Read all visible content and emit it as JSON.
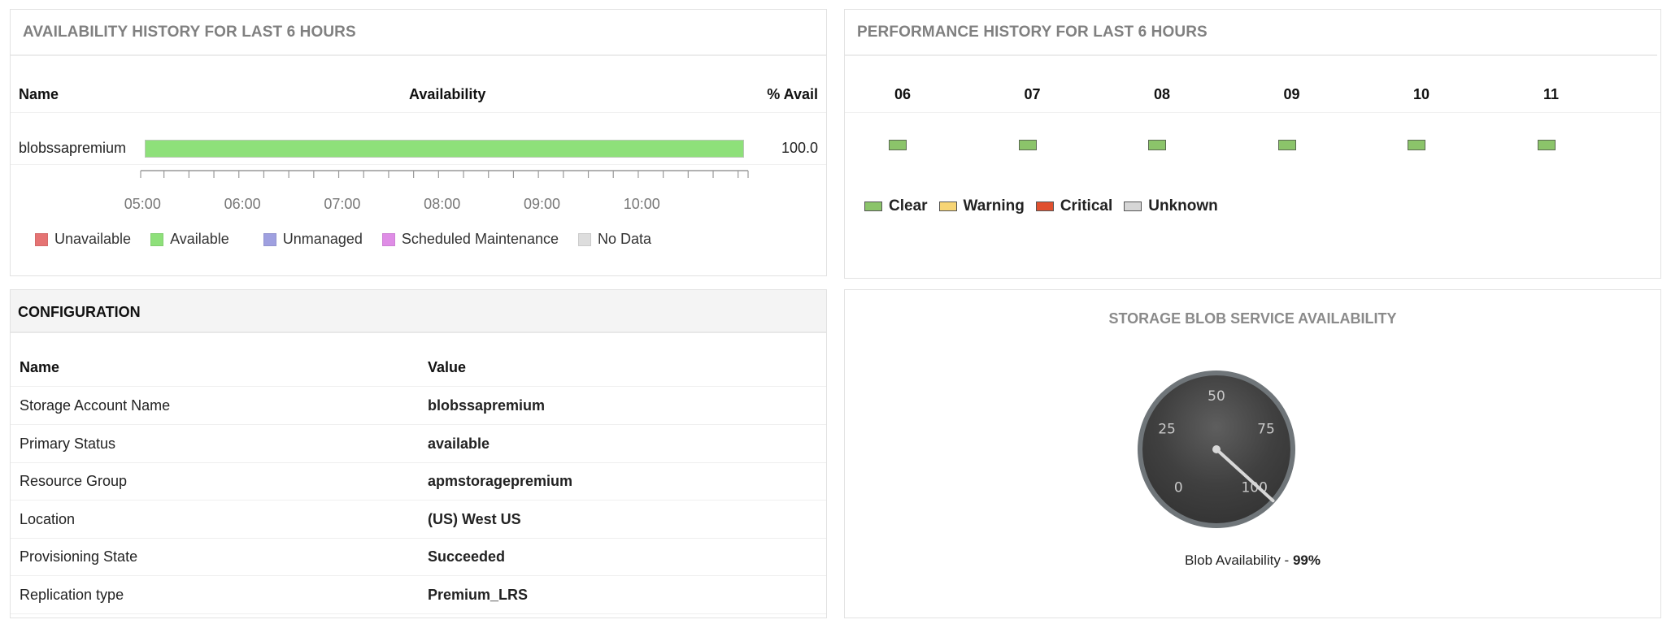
{
  "availability": {
    "title": "AVAILABILITY HISTORY FOR LAST 6 HOURS",
    "columns": {
      "name": "Name",
      "availability": "Availability",
      "pct": "% Avail"
    },
    "rows": [
      {
        "name": "blobssapremium",
        "status": "Available",
        "percent": "100.0"
      }
    ],
    "axis": {
      "start": "04:53",
      "end": "10:58",
      "labels": [
        "05:00",
        "06:00",
        "07:00",
        "08:00",
        "09:00",
        "10:00"
      ],
      "minor_tick_minutes": 15
    },
    "legend": [
      {
        "label": "Unavailable",
        "color": "#e57373"
      },
      {
        "label": "Available",
        "color": "#8ee07a"
      },
      {
        "label": "Unmanaged",
        "color": "#9fa0e0"
      },
      {
        "label": "Scheduled Maintenance",
        "color": "#df8de6"
      },
      {
        "label": "No Data",
        "color": "#dddddd"
      }
    ]
  },
  "performance": {
    "title": "PERFORMANCE HISTORY FOR LAST 6 HOURS",
    "hours": [
      "06",
      "07",
      "08",
      "09",
      "10",
      "11"
    ],
    "statuses": [
      "Clear",
      "Clear",
      "Clear",
      "Clear",
      "Clear",
      "Clear"
    ],
    "legend": [
      {
        "label": "Clear",
        "color": "#8bc46a"
      },
      {
        "label": "Warning",
        "color": "#f7d575"
      },
      {
        "label": "Critical",
        "color": "#e0502f"
      },
      {
        "label": "Unknown",
        "color": "#d6d6d6"
      }
    ]
  },
  "configuration": {
    "title": "CONFIGURATION",
    "header": {
      "name": "Name",
      "value": "Value"
    },
    "rows": [
      {
        "name": "Storage Account Name",
        "value": "blobssapremium"
      },
      {
        "name": "Primary Status",
        "value": "available"
      },
      {
        "name": "Resource Group",
        "value": "apmstoragepremium"
      },
      {
        "name": "Location",
        "value": "(US) West US"
      },
      {
        "name": "Provisioning State",
        "value": "Succeeded"
      },
      {
        "name": "Replication type",
        "value": "Premium_LRS"
      }
    ]
  },
  "gauge": {
    "title": "STORAGE BLOB SERVICE AVAILABILITY",
    "value": 99,
    "min": 0,
    "max": 100,
    "tick_labels": [
      "0",
      "25",
      "50",
      "75",
      "100"
    ],
    "caption_prefix": "Blob Availability - ",
    "caption_value": "99%"
  }
}
